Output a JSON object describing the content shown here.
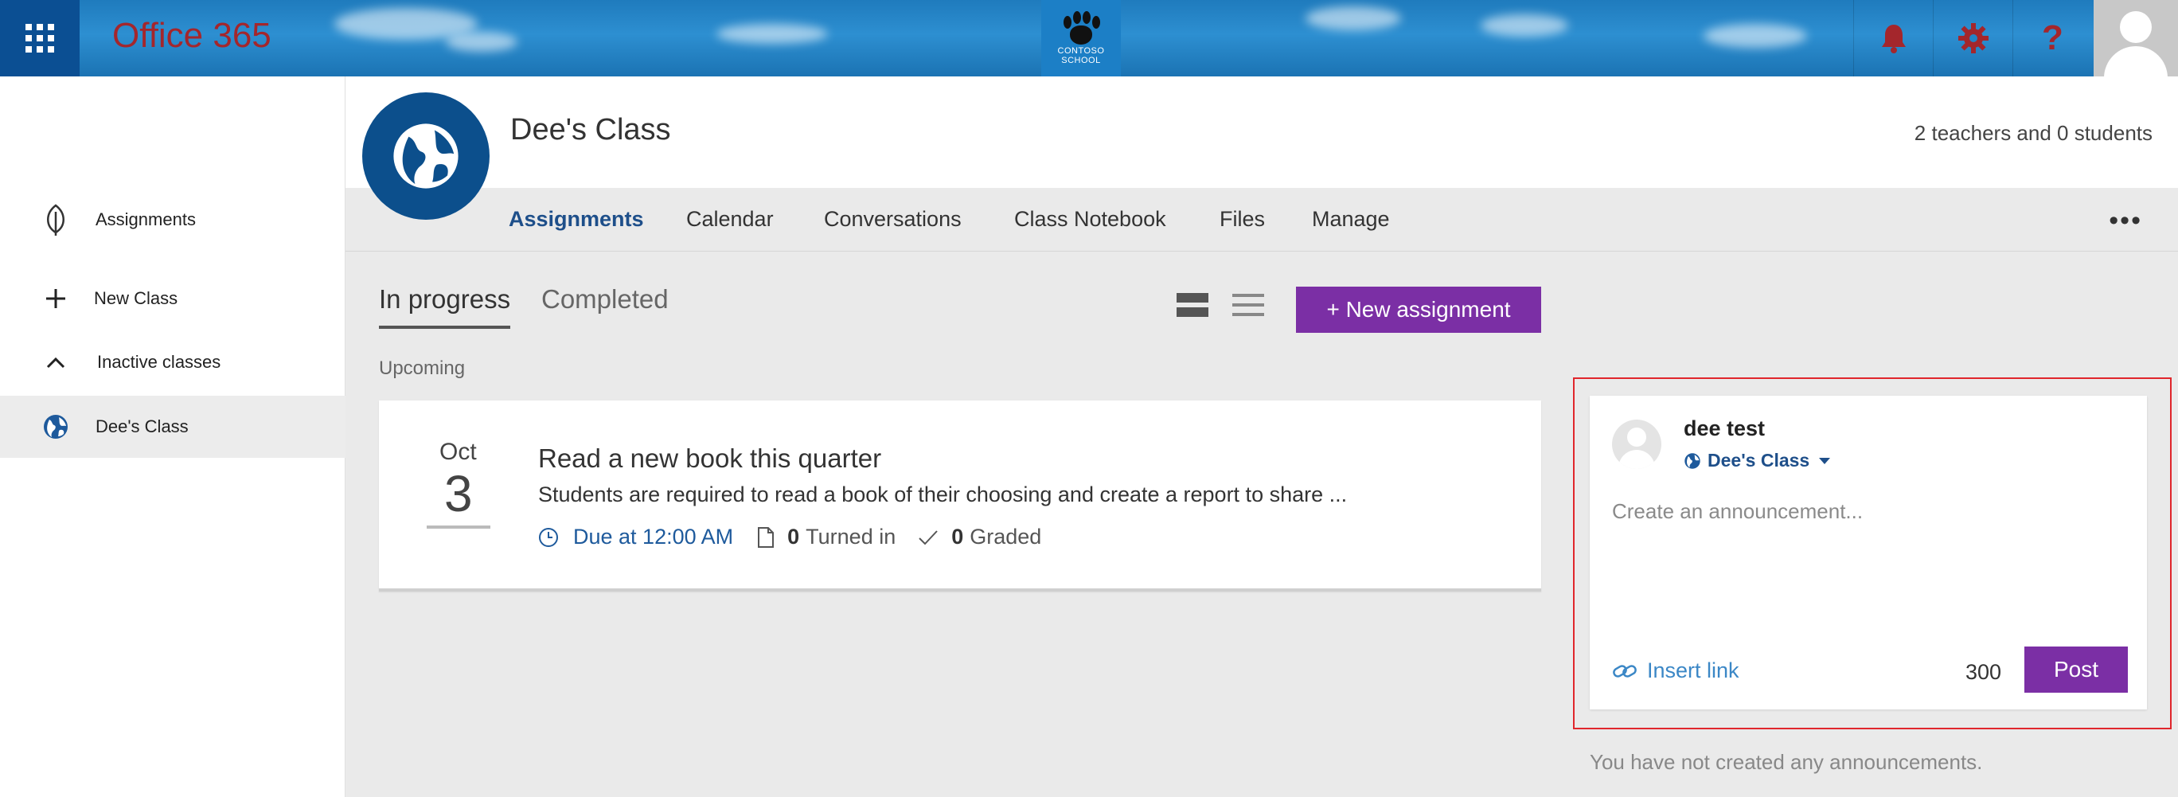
{
  "suite": {
    "brand": "Office 365",
    "logo_text_1": "CONTOSO",
    "logo_text_2": "SCHOOL",
    "icons": [
      "waffle-icon",
      "bell-icon",
      "gear-icon",
      "help-icon",
      "user-avatar-icon"
    ]
  },
  "sidebar": {
    "items": [
      {
        "label": "Assignments",
        "icon": "leaf-icon"
      },
      {
        "label": "New Class",
        "icon": "plus-icon"
      },
      {
        "label": "Inactive classes",
        "icon": "chevron-up-icon"
      },
      {
        "label": "Dee's Class",
        "icon": "globe-icon"
      }
    ]
  },
  "class": {
    "title": "Dee's Class",
    "members": "2 teachers and 0 students",
    "tabs": [
      {
        "label": "Assignments"
      },
      {
        "label": "Calendar"
      },
      {
        "label": "Conversations"
      },
      {
        "label": "Class Notebook"
      },
      {
        "label": "Files"
      },
      {
        "label": "Manage"
      }
    ],
    "more": "•••"
  },
  "assignments": {
    "subtabs": [
      "In progress",
      "Completed"
    ],
    "new_button": "+  New assignment",
    "section": "Upcoming",
    "card": {
      "month": "Oct",
      "day": "3",
      "title": "Read a new book this quarter",
      "description": "Students are required to read a book of their choosing and create a report to share ...",
      "due": "Due at 12:00 AM",
      "turned_in_count": "0",
      "turned_in_label": "Turned in",
      "graded_count": "0",
      "graded_label": "Graded"
    }
  },
  "announcement": {
    "user": "dee test",
    "class": "Dee's Class",
    "placeholder": "Create an announcement...",
    "insert_link": "Insert link",
    "char_count": "300",
    "post": "Post",
    "empty": "You have not created any announcements."
  },
  "colors": {
    "accent_purple": "#7b2fa5",
    "nav_blue": "#1e4f8a",
    "brand_red": "#a4262c",
    "class_circle": "#0c4f8c",
    "highlight_outline": "#e0262c"
  }
}
